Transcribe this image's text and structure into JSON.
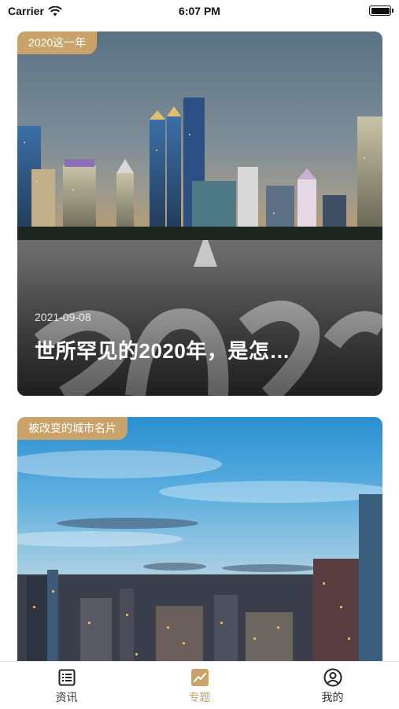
{
  "status_bar": {
    "carrier": "Carrier",
    "time": "6:07 PM"
  },
  "feed": {
    "cards": [
      {
        "tag": "2020这一年",
        "date": "2021-09-08",
        "title": "世所罕见的2020年，是怎…"
      },
      {
        "tag": "被改变的城市名片"
      }
    ]
  },
  "tab_bar": {
    "tabs": [
      {
        "label": "资讯",
        "icon": "news-list-icon"
      },
      {
        "label": "专题",
        "icon": "trend-chart-icon",
        "active": true
      },
      {
        "label": "我的",
        "icon": "user-profile-icon"
      }
    ],
    "accent_color": "#c9a36a"
  }
}
